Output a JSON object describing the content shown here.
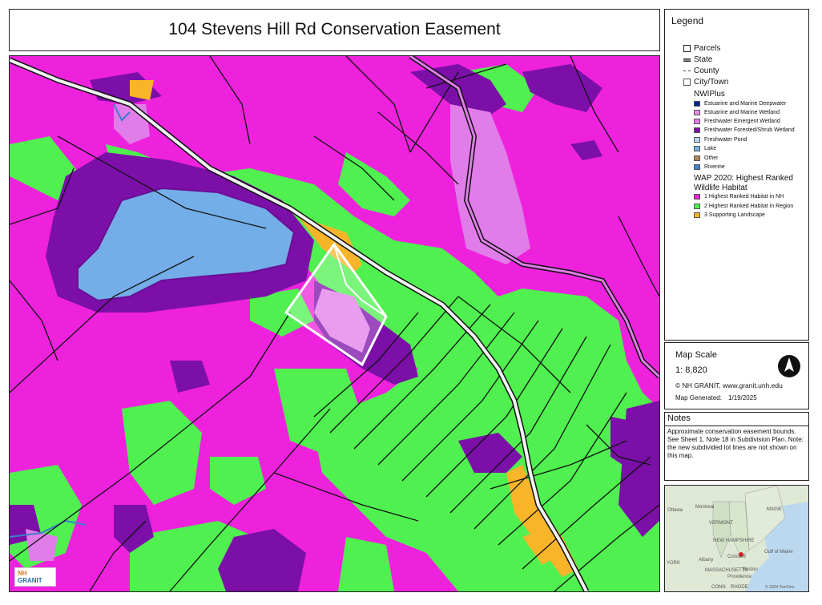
{
  "title": "104 Stevens Hill Rd Conservation Easement",
  "legend": {
    "title": "Legend",
    "boundaries": [
      {
        "label": "Parcels",
        "icon": "parcel-box-icon"
      },
      {
        "label": "State",
        "icon": "state-line-icon"
      },
      {
        "label": "County",
        "icon": "county-line-icon"
      },
      {
        "label": "City/Town",
        "icon": "town-box-icon"
      }
    ],
    "nwi_heading": "NWIPlus",
    "nwi_items": [
      {
        "label": "Estuarine and Marine Deepwater",
        "color": "#0a1f8f"
      },
      {
        "label": "Estuarine and Marine Wetland",
        "color": "#e98fe6"
      },
      {
        "label": "Freshwater Emergent Wetland",
        "color": "#e07de9"
      },
      {
        "label": "Freshwater Forested/Shrub Wetland",
        "color": "#7b0fa8"
      },
      {
        "label": "Freshwater Pond",
        "color": "#b8d6f5"
      },
      {
        "label": "Lake",
        "color": "#74aee8"
      },
      {
        "label": "Other",
        "color": "#b08858"
      },
      {
        "label": "Riverine",
        "color": "#3d7fc9"
      }
    ],
    "wap_heading": "WAP 2020: Highest Ranked Wildlife Habitat",
    "wap_items": [
      {
        "label": "1 Highest Ranked Habitat in NH",
        "color": "#ee22dd"
      },
      {
        "label": "2 Highest Ranked Habitat in Region",
        "color": "#4ff04f"
      },
      {
        "label": "3 Supporting Landscape",
        "color": "#f8b52a"
      }
    ]
  },
  "scale": {
    "label": "Map Scale",
    "value": "1: 8,820",
    "credit": "© NH GRANIT, www.granit.unh.edu",
    "generated_label": "Map Generated:",
    "generated_date": "1/19/2025"
  },
  "notes": {
    "title": "Notes",
    "text": "Approximate conservation easement bounds. See Sheet 1, Note 18 in Subdivision Plan. Note: the new subdivided lot lines are not shown on this map."
  },
  "logo": {
    "line1": "NH",
    "line2": "GRANIT"
  },
  "locator": {
    "labels": [
      "Ottawa",
      "Montreal",
      "MAINE",
      "VERMONT",
      "NEW HAMPSHIRE",
      "Gulf of Maine",
      "Albany",
      "Concord",
      "MASSACHUSETTS",
      "Boston",
      "Providence",
      "YORK",
      "CONN",
      "RHODE"
    ],
    "credit": "© 2024 TomTom"
  },
  "colors": {
    "habitat_nh": "#ee22dd",
    "habitat_region": "#4ff04f",
    "supporting": "#f8b52a",
    "forested_wetland": "#7b0fa8",
    "emergent_wetland": "#e07de9",
    "lake": "#74aee8",
    "easement_outline": "#ffffff"
  }
}
